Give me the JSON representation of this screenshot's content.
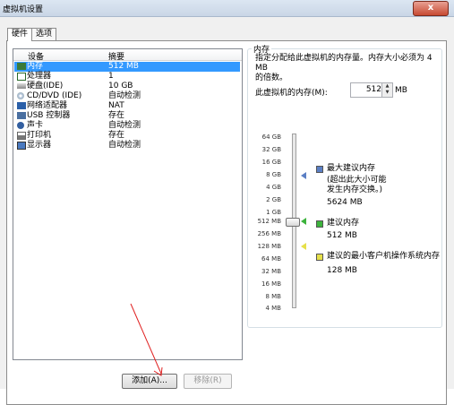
{
  "window": {
    "title": "虚拟机设置",
    "close_label": "x"
  },
  "tabs": [
    {
      "label": "硬件"
    },
    {
      "label": "选项"
    }
  ],
  "device_list": {
    "col_device": "设备",
    "col_summary": "摘要",
    "rows": [
      {
        "name": "内存",
        "summary": "512 MB",
        "icon": "memory-icon"
      },
      {
        "name": "处理器",
        "summary": "1",
        "icon": "processor-icon"
      },
      {
        "name": "硬盘(IDE)",
        "summary": "10 GB",
        "icon": "hard-disk-icon"
      },
      {
        "name": "CD/DVD (IDE)",
        "summary": "自动检测",
        "icon": "cd-dvd-icon"
      },
      {
        "name": "网络适配器",
        "summary": "NAT",
        "icon": "network-adapter-icon"
      },
      {
        "name": "USB 控制器",
        "summary": "存在",
        "icon": "usb-controller-icon"
      },
      {
        "name": "声卡",
        "summary": "自动检测",
        "icon": "sound-card-icon"
      },
      {
        "name": "打印机",
        "summary": "存在",
        "icon": "printer-icon"
      },
      {
        "name": "显示器",
        "summary": "自动检测",
        "icon": "display-icon"
      }
    ]
  },
  "buttons": {
    "add": "添加(A)...",
    "remove": "移除(R)"
  },
  "memory": {
    "group_title": "内存",
    "description_line1": "指定分配给此虚拟机的内存量。内存大小必须为 4 MB",
    "description_line2": "的倍数。",
    "field_label": "此虚拟机的内存(M):",
    "value": "512",
    "unit": "MB",
    "scale_labels": [
      "64 GB",
      "32 GB",
      "16 GB",
      "8 GB",
      "4 GB",
      "2 GB",
      "1 GB",
      "512 MB",
      "256 MB",
      "128 MB",
      "64 MB",
      "32 MB",
      "16 MB",
      "8 MB",
      "4 MB"
    ],
    "legend": {
      "max_title": "最大建议内存",
      "max_note1": "(超出此大小可能",
      "max_note2": "发生内存交换。)",
      "max_value": "5624 MB",
      "rec_title": "建议内存",
      "rec_value": "512 MB",
      "min_title": "建议的最小客户机操作系统内存",
      "min_value": "128 MB"
    },
    "colors": {
      "max": "#5b7fc4",
      "rec": "#3cb33c",
      "min": "#e6e04a"
    }
  }
}
